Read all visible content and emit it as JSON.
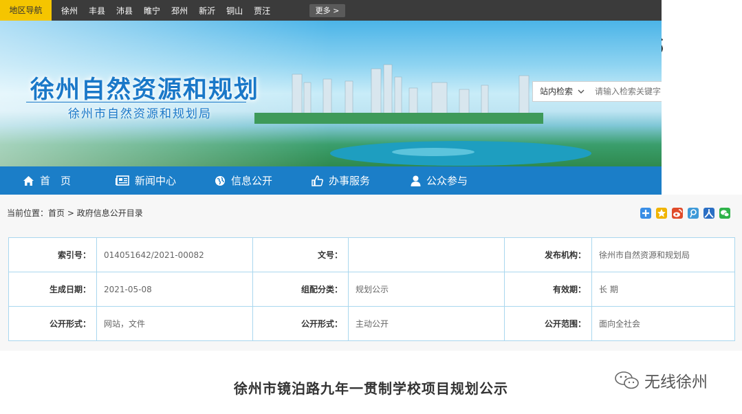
{
  "region_nav": {
    "label": "地区导航",
    "links": [
      "徐州",
      "丰县",
      "沛县",
      "睢宁",
      "邳州",
      "新沂",
      "铜山",
      "贾汪"
    ],
    "more": "更多 >"
  },
  "banner": {
    "title": "徐州自然资源和规划",
    "subtitle": "徐州市自然资源和规划局"
  },
  "search": {
    "scope": "站内检索",
    "placeholder": "请输入检索关键字"
  },
  "nav": {
    "items": [
      {
        "label": "首　页",
        "icon": "home-icon"
      },
      {
        "label": "新闻中心",
        "icon": "newspaper-icon"
      },
      {
        "label": "信息公开",
        "icon": "globe-icon"
      },
      {
        "label": "办事服务",
        "icon": "thumbs-up-icon"
      },
      {
        "label": "公众参与",
        "icon": "user-icon"
      }
    ]
  },
  "breadcrumb": {
    "prefix": "当前位置：",
    "home": "首页",
    "sep": " > ",
    "current": "政府信息公开目录"
  },
  "share_icons": [
    "share-plus-icon",
    "qzone-icon",
    "weibo-icon",
    "tencent-weibo-icon",
    "renren-icon",
    "wechat-icon"
  ],
  "share_colors": [
    "#3a8ee6",
    "#f0b400",
    "#e04b2a",
    "#3f9ad8",
    "#2b6fc4",
    "#2fb34a"
  ],
  "info": {
    "rows": [
      [
        {
          "label": "索引号：",
          "value": "014051642/2021-00082"
        },
        {
          "label": "文号：",
          "value": ""
        },
        {
          "label": "发布机构：",
          "value": "徐州市自然资源和规划局"
        }
      ],
      [
        {
          "label": "生成日期：",
          "value": "2021-05-08"
        },
        {
          "label": "组配分类：",
          "value": "规划公示"
        },
        {
          "label": "有效期：",
          "value": "长 期"
        }
      ],
      [
        {
          "label": "公开形式：",
          "value": "网站，文件"
        },
        {
          "label": "公开形式：",
          "value": "主动公开"
        },
        {
          "label": "公开范围：",
          "value": "面向全社会"
        }
      ]
    ]
  },
  "article": {
    "title": "徐州市镜泊路九年一贯制学校项目规划公示"
  },
  "watermark": {
    "text": "无线徐州"
  }
}
